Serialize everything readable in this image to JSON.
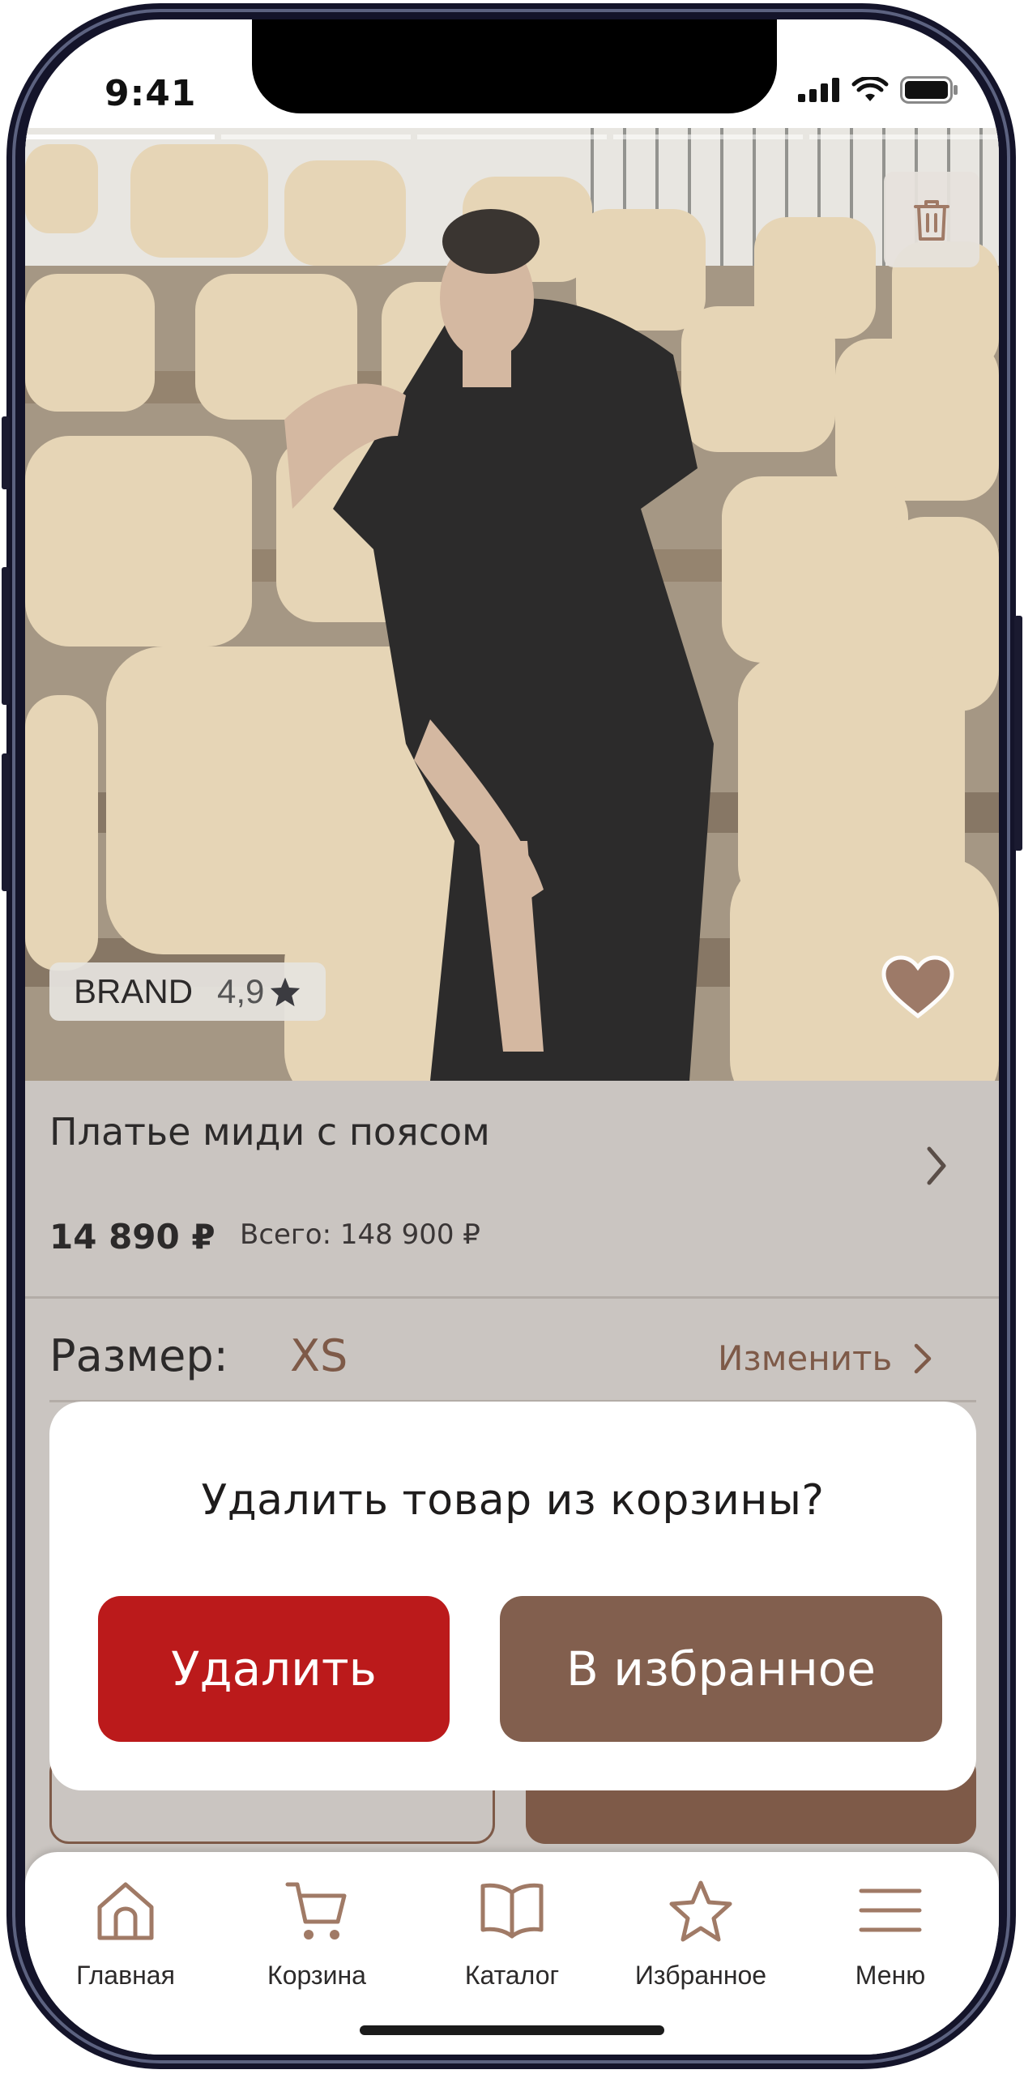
{
  "status_bar": {
    "time": "9:41"
  },
  "product": {
    "brand": "BRAND",
    "rating": "4,9",
    "title": "Платье миди с поясом",
    "price": "14 890 ₽",
    "total": "Всего: 148 900 ₽"
  },
  "size": {
    "label": "Размер:",
    "value": "XS",
    "change_label": "Изменить"
  },
  "dialog": {
    "question": "Удалить  товар из корзины?",
    "delete_label": "Удалить",
    "favorite_label": "В избранное"
  },
  "tabbar": {
    "items": [
      {
        "label": "Главная",
        "icon": "home-icon"
      },
      {
        "label": "Корзина",
        "icon": "cart-icon"
      },
      {
        "label": "Каталог",
        "icon": "book-icon"
      },
      {
        "label": "Избранное",
        "icon": "star-icon"
      },
      {
        "label": "Меню",
        "icon": "menu-icon"
      }
    ]
  },
  "colors": {
    "accent_brown": "#825f4e",
    "danger_red": "#bb1a1b",
    "overlay_gray": "#cac5c1"
  }
}
